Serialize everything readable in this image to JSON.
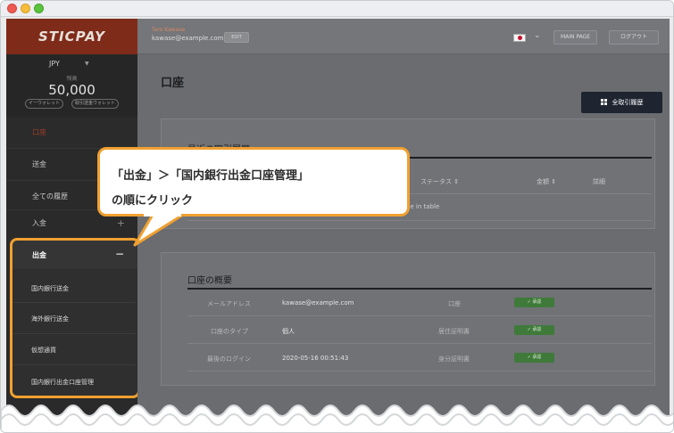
{
  "sidebar": {
    "logo": "STICPAY",
    "currency": "JPY",
    "balance_label": "残高",
    "balance": "50,000",
    "ewallet_btn": "イーウォレット",
    "ewallet2_btn": "取引送金ウォレット",
    "nav": [
      {
        "label": "口座"
      },
      {
        "label": "送金"
      },
      {
        "label": "全ての履歴"
      },
      {
        "label": "入金",
        "plus": "+"
      }
    ],
    "withdraw": {
      "label": "出金",
      "toggle": "−",
      "items": [
        {
          "label": "国内銀行送金"
        },
        {
          "label": "海外銀行送金"
        },
        {
          "label": "仮想通貨"
        },
        {
          "label": "国内銀行出金口座管理"
        }
      ]
    }
  },
  "topbar": {
    "user_name": "Taro Kawase",
    "user_email": "kawase@example.com",
    "edit": "EDIT",
    "main_page": "MAIN PAGE",
    "logout": "ログアウト"
  },
  "main": {
    "title": "口座",
    "all_history_btn": "全取引履歴",
    "recent": {
      "title": "最近の取引履歴",
      "columns": [
        "ステータス ⇕",
        "金額 ⇕",
        "詳細"
      ],
      "empty": "ble in table"
    },
    "summary": {
      "title": "口座の概要",
      "rows": [
        {
          "label": "メールアドレス",
          "value": "kawase@example.com",
          "doc": "口座",
          "status": "✓ 承認"
        },
        {
          "label": "口座のタイプ",
          "value": "個人",
          "doc": "居住証明書",
          "status": "✓ 承認"
        },
        {
          "label": "最後のログイン",
          "value": "2020-05-16 00:51:43",
          "doc": "身分証明書",
          "status": "✓ 承認"
        }
      ]
    }
  },
  "callout": {
    "line1": "「出金」＞「国内銀行出金口座管理」",
    "line2": "の順にクリック"
  },
  "colors": {
    "highlight": "#f0a030",
    "logo_bg": "#7e2b1a",
    "status_green": "#3f7a3a",
    "dark_button": "#1e2430"
  }
}
